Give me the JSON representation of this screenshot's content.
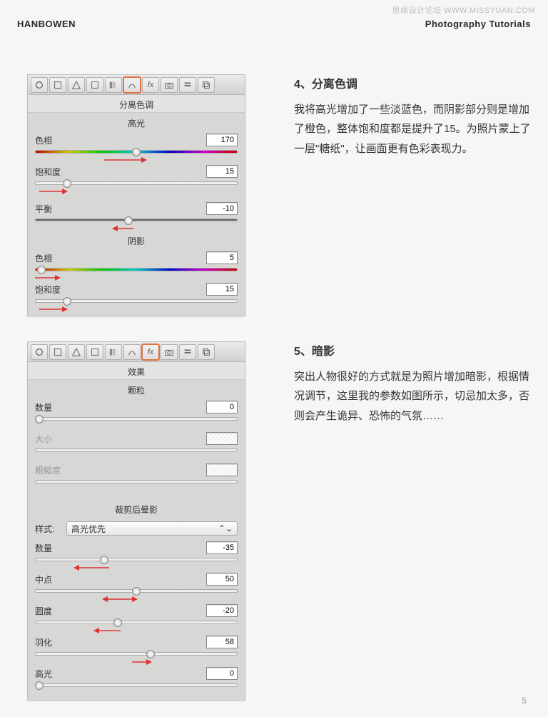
{
  "watermark": "思缘设计论坛  WWW.MISSYUAN.COM",
  "header": {
    "left": "HANBOWEN",
    "right": "Photography Tutorials"
  },
  "page_number": "5",
  "section4": {
    "title": "4、分离色调",
    "body": "我将高光增加了一些淡蓝色，而阴影部分则是增加了橙色，整体饱和度都是提升了15。为照片蒙上了一层\"糖纸\"，让画面更有色彩表现力。",
    "panel_title": "分离色调",
    "highlights_label": "高光",
    "hue_label": "色相",
    "sat_label": "饱和度",
    "balance_label": "平衡",
    "shadows_label": "阴影",
    "highlight_hue": "170",
    "highlight_sat": "15",
    "balance": "-10",
    "shadow_hue": "5",
    "shadow_sat": "15"
  },
  "section5": {
    "title": "5、暗影",
    "body": "突出人物很好的方式就是为照片增加暗影，根据情况调节，这里我的参数如图所示，切忌加太多，否则会产生诡异、恐怖的气氛……",
    "panel_title": "效果",
    "grain_label": "颗粒",
    "amount_label": "数量",
    "size_label": "大小",
    "roughness_label": "粗糙度",
    "grain_amount": "0",
    "vignette_label": "裁剪后晕影",
    "style_label": "样式:",
    "style_value": "高光优先",
    "v_amount_label": "数量",
    "midpoint_label": "中点",
    "roundness_label": "圆度",
    "feather_label": "羽化",
    "highlights_label": "高光",
    "v_amount": "-35",
    "midpoint": "50",
    "roundness": "-20",
    "feather": "58",
    "highlights": "0"
  }
}
